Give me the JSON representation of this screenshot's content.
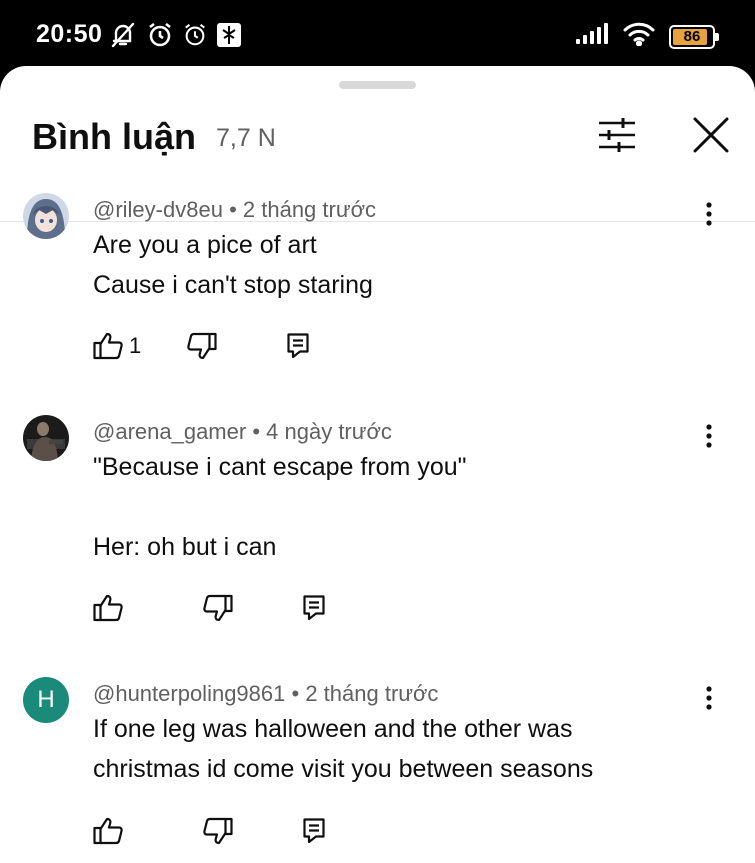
{
  "status_bar": {
    "time": "20:50",
    "battery_level": "86",
    "accent_battery": "#e6a23c",
    "icons_left": [
      "notifications-muted-icon",
      "alarm-icon",
      "alarm-icon",
      "app-notification-icon"
    ],
    "icons_right": [
      "cell-signal-icon",
      "wifi-icon",
      "battery-icon"
    ]
  },
  "header": {
    "title": "Bình luận",
    "count": "7,7 N"
  },
  "comments": [
    {
      "author": "@riley-dv8eu",
      "time": "2 tháng trước",
      "lines": [
        "Are you a pice of art",
        "Cause i can't stop staring"
      ],
      "likes": "1"
    },
    {
      "author": "@arena_gamer",
      "time": "4 ngày trước",
      "lines": [
        "\"Because i cant escape from you\"",
        "",
        "Her: oh but i can"
      ],
      "likes": ""
    },
    {
      "author": "@hunterpoling9861",
      "time": "2 tháng trước",
      "lines": [
        "If one leg was halloween and the other was",
        "christmas id come visit you between seasons"
      ],
      "likes": "",
      "avatar_letter": "H",
      "avatar_color": "#1a8a7a"
    }
  ],
  "separator": "•"
}
